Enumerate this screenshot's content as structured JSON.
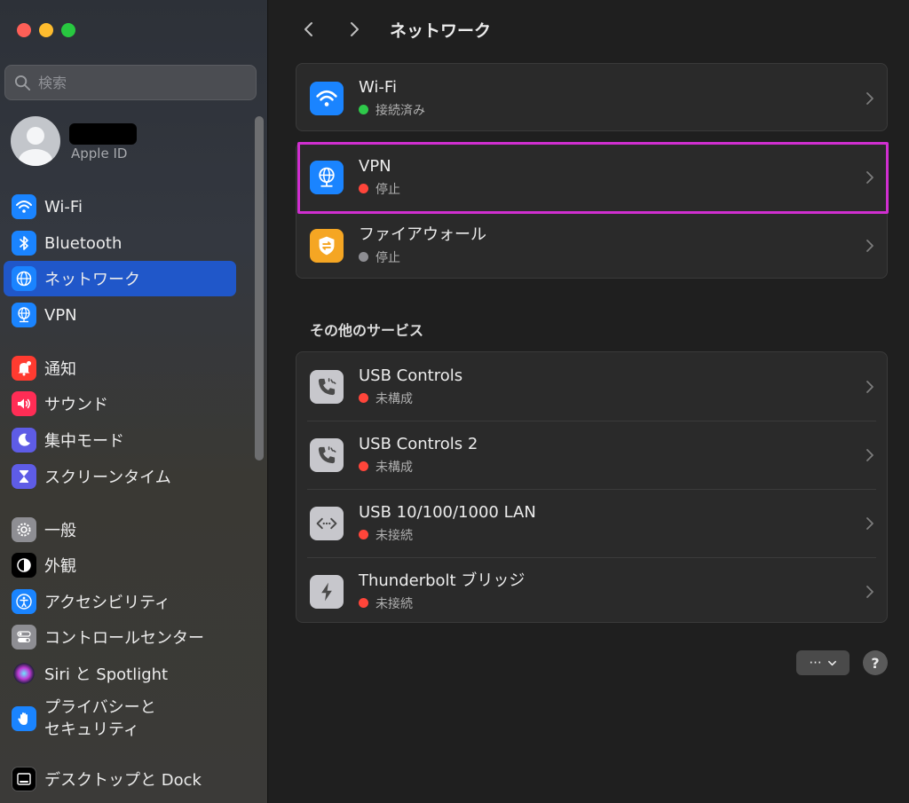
{
  "sidebar": {
    "search_placeholder": "検索",
    "apple_id_label": "Apple ID",
    "items": [
      {
        "label": "Wi-Fi"
      },
      {
        "label": "Bluetooth"
      },
      {
        "label": "ネットワーク"
      },
      {
        "label": "VPN"
      },
      {
        "label": "通知"
      },
      {
        "label": "サウンド"
      },
      {
        "label": "集中モード"
      },
      {
        "label": "スクリーンタイム"
      },
      {
        "label": "一般"
      },
      {
        "label": "外観"
      },
      {
        "label": "アクセシビリティ"
      },
      {
        "label": "コントロールセンター"
      },
      {
        "label": "Siri と Spotlight"
      },
      {
        "label_line1": "プライバシーと",
        "label_line2": "セキュリティ"
      },
      {
        "label": "デスクトップと Dock"
      }
    ],
    "selected_item": "ネットワーク"
  },
  "main": {
    "title": "ネットワーク",
    "primary_services": [
      {
        "name": "Wi-Fi",
        "status": "接続済み",
        "status_color": "#2ec94a",
        "icon": "wifi-icon",
        "icon_bg": "#1a84ff"
      },
      {
        "name": "VPN",
        "status": "停止",
        "status_color": "#ff453a",
        "icon": "globe-network-icon",
        "icon_bg": "#1a84ff"
      },
      {
        "name": "ファイアウォール",
        "status": "停止",
        "status_color": "#8e8e93",
        "icon": "firewall-shield-icon",
        "icon_bg": "#f5a623"
      }
    ],
    "other_services_title": "その他のサービス",
    "other_services": [
      {
        "name": "USB Controls",
        "status": "未構成",
        "status_color": "#ff453a",
        "icon": "phone-icon"
      },
      {
        "name": "USB Controls 2",
        "status": "未構成",
        "status_color": "#ff453a",
        "icon": "phone-icon"
      },
      {
        "name": "USB 10/100/1000 LAN",
        "status": "未接続",
        "status_color": "#ff453a",
        "icon": "ethernet-icon"
      },
      {
        "name": "Thunderbolt ブリッジ",
        "status": "未接続",
        "status_color": "#ff453a",
        "icon": "thunderbolt-icon"
      }
    ],
    "more_button_label": "···",
    "help_button_label": "?"
  },
  "colors": {
    "accent": "#2057c9",
    "highlight": "#d02fd0"
  }
}
